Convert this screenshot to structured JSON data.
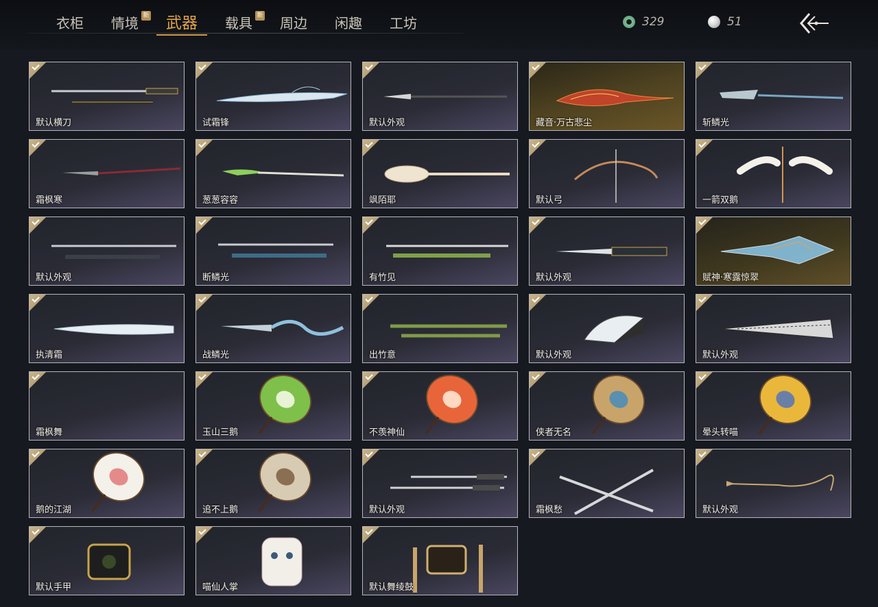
{
  "tabs": [
    {
      "label": "衣柜",
      "new": false,
      "active": false
    },
    {
      "label": "情境",
      "new": true,
      "active": false
    },
    {
      "label": "武器",
      "new": false,
      "active": true
    },
    {
      "label": "载具",
      "new": true,
      "active": false
    },
    {
      "label": "周边",
      "new": false,
      "active": false
    },
    {
      "label": "闲趣",
      "new": false,
      "active": false
    },
    {
      "label": "工坊",
      "new": false,
      "active": false
    }
  ],
  "new_badge": "新",
  "currency": {
    "jade": {
      "icon": "jade-coin-icon",
      "value": "329"
    },
    "pearl": {
      "icon": "pearl-icon",
      "value": "51"
    }
  },
  "back_icon": "back-arrow-icon",
  "colors": {
    "accent": "#e0a447",
    "background": "#16191f",
    "card_border": "#b8b8bc"
  },
  "items": [
    {
      "name": "默认横刀",
      "art": "sword"
    },
    {
      "name": "试霜锋",
      "art": "frost-blade"
    },
    {
      "name": "默认外观",
      "art": "spear"
    },
    {
      "name": "藏音·万古悲尘",
      "art": "flame-blade",
      "style": "gold"
    },
    {
      "name": "斩鳞光",
      "art": "blade-spear"
    },
    {
      "name": "霜枫寒",
      "art": "spear-red"
    },
    {
      "name": "葱葱容容",
      "art": "leek-spear"
    },
    {
      "name": "飒陌耶",
      "art": "oar"
    },
    {
      "name": "默认弓",
      "art": "bow"
    },
    {
      "name": "一箭双鹅",
      "art": "bow-goose"
    },
    {
      "name": "默认外观",
      "art": "sword-sheath"
    },
    {
      "name": "断鳞光",
      "art": "sword-sheath-blue"
    },
    {
      "name": "有竹见",
      "art": "bamboo-sword"
    },
    {
      "name": "默认外观",
      "art": "ornate-sword"
    },
    {
      "name": "赋神·寒露惊翠",
      "art": "crystal-blade",
      "style": "gold2"
    },
    {
      "name": "执清霜",
      "art": "ice-blade"
    },
    {
      "name": "战鳞光",
      "art": "dragon-blade"
    },
    {
      "name": "出竹意",
      "art": "bamboo"
    },
    {
      "name": "默认外观",
      "art": "fan"
    },
    {
      "name": "默认外观",
      "art": "closed-fan"
    },
    {
      "name": "霜枫舞",
      "art": "none"
    },
    {
      "name": "玉山三鹅",
      "art": "umbrella-green"
    },
    {
      "name": "不羡神仙",
      "art": "umbrella-orange"
    },
    {
      "name": "侠者无名",
      "art": "umbrella-blue"
    },
    {
      "name": "晕头转喵",
      "art": "umbrella-yellow"
    },
    {
      "name": "鹅的江湖",
      "art": "umbrella-white"
    },
    {
      "name": "追不上鹅",
      "art": "umbrella-beige"
    },
    {
      "name": "默认外观",
      "art": "twin-swords"
    },
    {
      "name": "霜枫愁",
      "art": "crossed-blades"
    },
    {
      "name": "默认外观",
      "art": "rope-dart"
    },
    {
      "name": "默认手甲",
      "art": "gauntlet"
    },
    {
      "name": "喵仙人掌",
      "art": "cat-paw"
    },
    {
      "name": "默认舞绫鼓",
      "art": "drum"
    }
  ]
}
